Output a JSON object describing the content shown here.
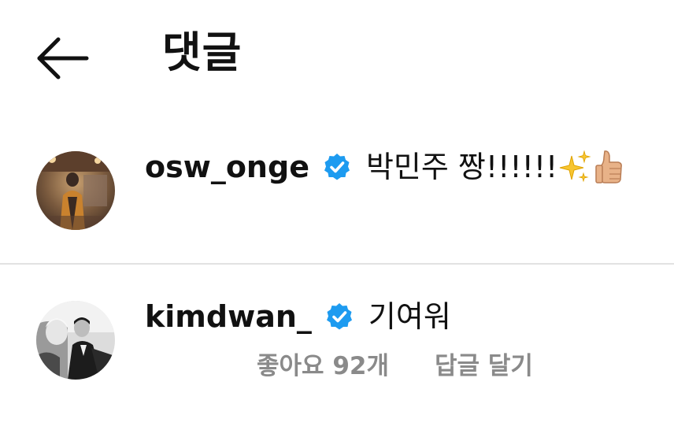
{
  "header": {
    "title": "댓글",
    "back_icon": "arrow-left-icon"
  },
  "comments": [
    {
      "username": "osw_onge",
      "verified": true,
      "text": "박민주 짱!!!!!!",
      "emojis": [
        "sparkles-emoji",
        "thumbs-up-emoji"
      ]
    },
    {
      "username": "kimdwan_",
      "verified": true,
      "text": "기여워",
      "likes_label": "좋아요 92개",
      "reply_label": "답글 달기"
    }
  ],
  "colors": {
    "text": "#111111",
    "muted": "#8a8a8a",
    "verified_blue": "#1d9bf0",
    "divider": "#e2e2e2"
  }
}
